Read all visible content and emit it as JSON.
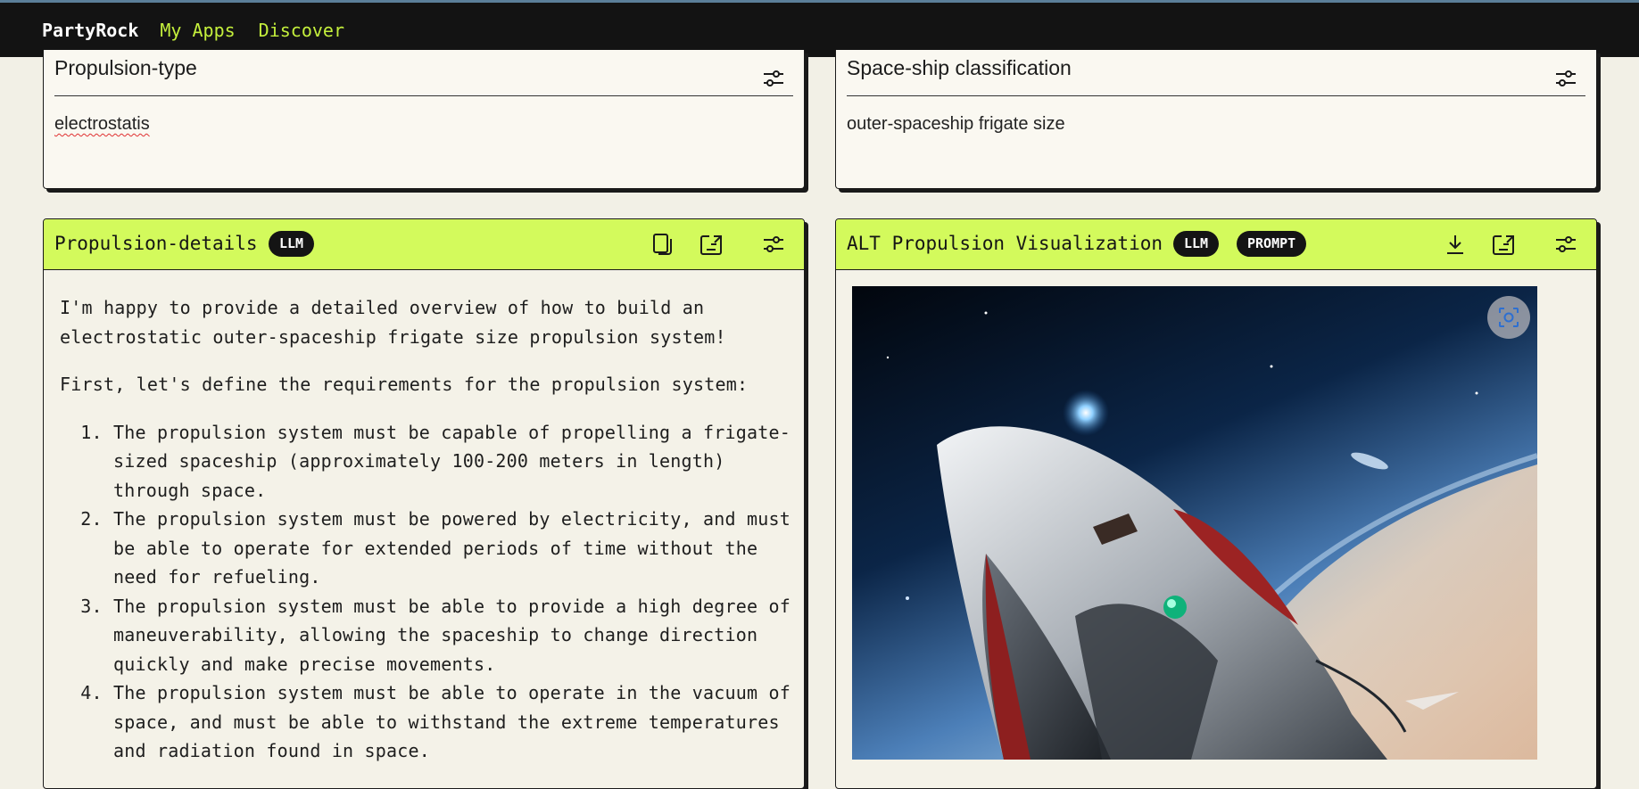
{
  "topbar": {
    "brand": "PartyRock",
    "nav": [
      "My Apps",
      "Discover"
    ]
  },
  "widgets": {
    "propulsion_type": {
      "title": "Propulsion-type",
      "value": "electrostatis"
    },
    "spaceship_classification": {
      "title": "Space-ship classification",
      "value": "outer-spaceship frigate size"
    },
    "propulsion_details": {
      "title": "Propulsion-details",
      "badge": "LLM",
      "intro": "I'm happy to provide a detailed overview of how to build an electrostatic outer-spaceship frigate size propulsion system!",
      "requirements_intro": "First, let's define the requirements for the propulsion system:",
      "requirements": [
        "The propulsion system must be capable of propelling a frigate-sized spaceship (approximately 100-200 meters in length) through space.",
        "The propulsion system must be powered by electricity, and must be able to operate for extended periods of time without the need for refueling.",
        "The propulsion system must be able to provide a high degree of maneuverability, allowing the spaceship to change direction quickly and make precise movements.",
        "The propulsion system must be able to operate in the vacuum of space, and must be able to withstand the extreme temperatures and radiation found in space."
      ]
    },
    "alt_visualization": {
      "title": "ALT Propulsion Visualization",
      "badges": [
        "LLM",
        "PROMPT"
      ]
    }
  },
  "colors": {
    "topbar_bg": "#131313",
    "nav_accent": "#c4ef3c",
    "widget_header": "#d3fa5c",
    "page_bg": "#f2f0e6"
  },
  "icons": {
    "settings": "sliders-icon",
    "copy": "copy-icon",
    "export": "export-icon",
    "download": "download-icon",
    "image_lens": "image-search-icon"
  }
}
